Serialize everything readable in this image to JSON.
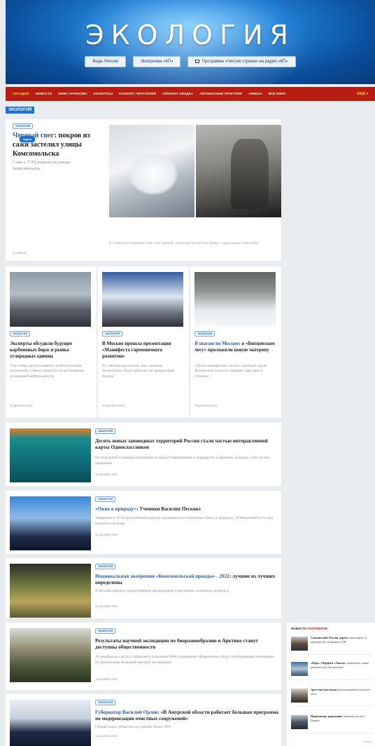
{
  "hero": {
    "title": "ЭКОЛОГИЯ",
    "links": [
      "Воды России",
      "Экопризма «КП»",
      "Программа «Чистая страна» на радио «КП»"
    ]
  },
  "topnav": {
    "items": [
      "СЕГОДНЯ",
      "НОВОСТИ",
      "ИНВА ЧУРИКОВА",
      "КОНКУРСЫ",
      "КОНКУРС ЧИТАТЕЛЕЙ",
      "УКРАИНА СВОДКА",
      "АВТОБУСНЫЕ ПРОГУЛКИ",
      "АФИША",
      "ВСЕ КИНО"
    ],
    "more": "ЕЩЁ ▾"
  },
  "section_label": "ЭКОЛОГИЯ",
  "badge_text": "ЭКОЛОГИЯ",
  "inline_badge": "видео",
  "feature": {
    "headline_hl": "Черный снег",
    "headline_rest": ": покров из сажи застелил улицы Комсомольска",
    "lead": "Сажа с ТЭЦ выпала на улицы Комсомольска",
    "date": "11 января",
    "caption": "В Сети было замечено что снег черный: реальный белый снег Фото: социальные сети видео"
  },
  "small_cards": [
    {
      "headline": "Эксперты обсудили будущее карбоновых бирж и рынка углеродных единиц",
      "lead": "Участники дискуссионного клуба Ecowhale рассказали о новых проектах по достижению углеродной нейтральности",
      "date": "29 декабря 2022"
    },
    {
      "headline": "В Москве прошла презентация «Манифеста гармоничного развития»",
      "lead": "Его авторы рассказали, как «зеленые технологии» будут работать на процветание России",
      "date": "28 декабря 2022"
    },
    {
      "headline_hl": "Я шагаю по Москве",
      "headline_rest": ": в «Битцевском лесу» проложили новую экотропу",
      "lead": "«Тропа знакомства с лесом» проходит вдоль Ясеневской аллеи и соединяет два округа столицы",
      "date": "28 декабря 2022"
    }
  ],
  "rows": [
    {
      "headline": "Десять новых заповедных территорий России стали частью интерактивной карты Одноклассников",
      "lead": "На отдельной странице пользователи найдут информацию о маршрутах и времени, которое стоит на них задержать",
      "date": "26 декабря 2022"
    },
    {
      "headline_hl": "«Окно в природу»",
      "headline_rest": ": Ученики Василия Пескова",
      "lead": "Завершился VI Всероссийский конкурс журналистов и блогеров «Окно в природу». Победителей в это раз оказалось больше",
      "date": "21 декабря 2022"
    },
    {
      "headline_hl": "Национальная экопремия «Комсомольской правды» - 2022",
      "headline_rest": ": лучшие из лучших определены",
      "lead": "В Москве прошло торжественное награждение участников «зеленого» конкурса",
      "date": "20 декабря 2022"
    },
    {
      "headline": "Результаты научной экспедиции по биоразнообразию в Арктике станут доступны общественности",
      "lead": "16 декабря на сайтах Сибирского отделения РАН и компании «Норникель» будут опубликованы материалы по результатам Большой научной экспедиции",
      "date": "15 декабря 2022"
    },
    {
      "headline_hl": "Губернатор Василий Орлов",
      "headline_rest": ": «В Амурской области работает большая программа по модернизации очистных сооружений»",
      "lead": "Общий износ объектов составляет более 60%",
      "date": "14 декабря 2022"
    }
  ],
  "sidebar": {
    "head_prefix": "НОВОСТИ",
    "head_accent": "ПАРТНЕРОВ",
    "items": [
      {
        "bold": "Сачковский: Россия дорого",
        "text": "инвестирует в партнерство на рынках СНГ"
      },
      {
        "bold": "«Перу» Мерфи и «Аккол»",
        "text": "проверили, какие рекламы для них реклама"
      },
      {
        "bold": "Арестант рассказал о",
        "text": "неожиданном повороте дела"
      },
      {
        "bold": "Нарышкин: нарежение",
        "text": "Украины на счет Крыма"
      }
    ],
    "foot": "Рекламы"
  }
}
